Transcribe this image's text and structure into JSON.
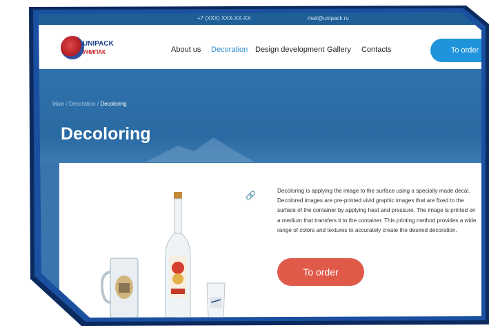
{
  "topbar": {
    "phone": "+7 (XXX) XXX-XX-XX",
    "email": "mail@unipack.ru"
  },
  "brand": {
    "logo_line1": "UNIPACK",
    "logo_line2": "УНИПАК"
  },
  "nav": {
    "items": [
      {
        "label": "About us",
        "active": false
      },
      {
        "label": "Decoration",
        "active": true
      },
      {
        "label": "Design development",
        "active": false
      },
      {
        "label": "Gallery",
        "active": false
      },
      {
        "label": "Contacts",
        "active": false
      }
    ],
    "order_label": "To order"
  },
  "breadcrumb": {
    "main": "Main",
    "sep1": " / ",
    "section": "Decoration",
    "sep2": " / ",
    "current": "Decoloring"
  },
  "page": {
    "title": "Decoloring",
    "description": "Decoloring is applying the image to the surface using a specially made decal. Decolored images are pre-printed vivid graphic images that are fixed to the surface of the container by applying heat and pressure. The image is printed on a medium that transfers it to the container. This printing method provides a wide range of colors and textures to accurately create the desired decoration.",
    "order_label": "To order"
  },
  "colors": {
    "accent_blue": "#1f94dd",
    "order_red": "#e05a4a",
    "hero_blue": "#2f72ad",
    "frame_navy": "#0b2a5e"
  }
}
